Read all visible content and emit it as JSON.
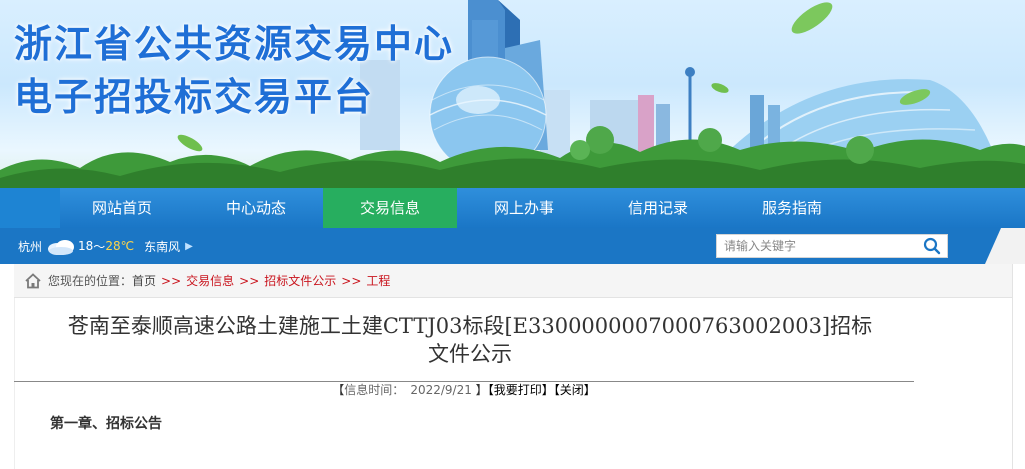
{
  "site": {
    "title_line1": "浙江省公共资源交易中心",
    "title_line2": "电子招投标交易平台"
  },
  "nav": {
    "items": [
      {
        "label": "网站首页",
        "active": false
      },
      {
        "label": "中心动态",
        "active": false
      },
      {
        "label": "交易信息",
        "active": true
      },
      {
        "label": "网上办事",
        "active": false
      },
      {
        "label": "信用记录",
        "active": false
      },
      {
        "label": "服务指南",
        "active": false
      }
    ]
  },
  "weather": {
    "city": "杭州",
    "icon": "cloud-icon",
    "temp_low": "18",
    "temp_sep": "～",
    "temp_high": "28℃",
    "wind": "东南风",
    "wind_arrow": "▶"
  },
  "search": {
    "placeholder": "请输入关键字",
    "value": "",
    "icon": "search-icon"
  },
  "breadcrumb": {
    "prefix": "您现在的位置：",
    "items": [
      "首页",
      "交易信息",
      "招标文件公示",
      "工程"
    ],
    "separator": ">>"
  },
  "article": {
    "title_line1": "苍南至泰顺高速公路土建施工土建CTTJ03标段[E3300000007000763002003]招标",
    "title_line2": "文件公示",
    "meta": {
      "open_bracket": "【",
      "time_label": "信息时间：",
      "date": "2022/9/21",
      "close_bracket": "】",
      "print_label": "【我要打印】",
      "close_label": "【关闭】"
    },
    "chapter": "第一章、招标公告"
  },
  "colors": {
    "brand_blue": "#1b76c5",
    "active_green": "#27ae5f",
    "crumb_red": "#c9151e",
    "title_blue": "#1f6fd6"
  }
}
